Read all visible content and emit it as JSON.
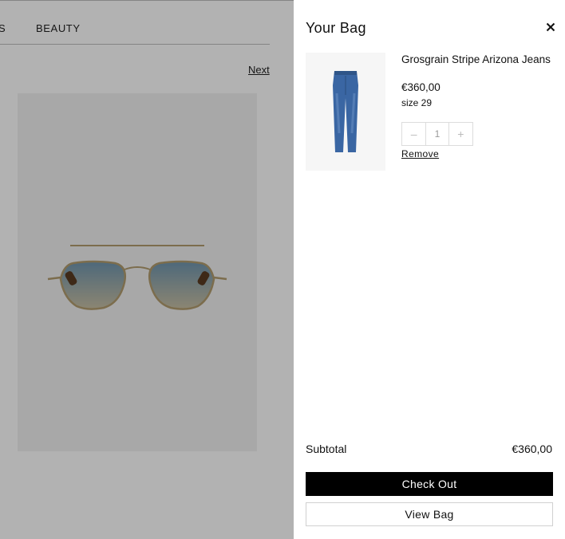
{
  "background_page": {
    "nav_partial": "S",
    "nav_beauty": "BEAUTY",
    "next_label": "Next",
    "product_icon": "sunglasses-image"
  },
  "bag": {
    "title": "Your Bag",
    "close_icon": "close-icon",
    "item": {
      "name": "Grosgrain Stripe Arizona Jeans",
      "price": "€360,00",
      "size": "size 29",
      "quantity": "1",
      "decrement_label": "–",
      "increment_label": "+",
      "remove_label": "Remove",
      "thumbnail_icon": "jeans-image"
    },
    "subtotal_label": "Subtotal",
    "subtotal_value": "€360,00",
    "checkout_label": "Check Out",
    "view_bag_label": "View Bag"
  }
}
